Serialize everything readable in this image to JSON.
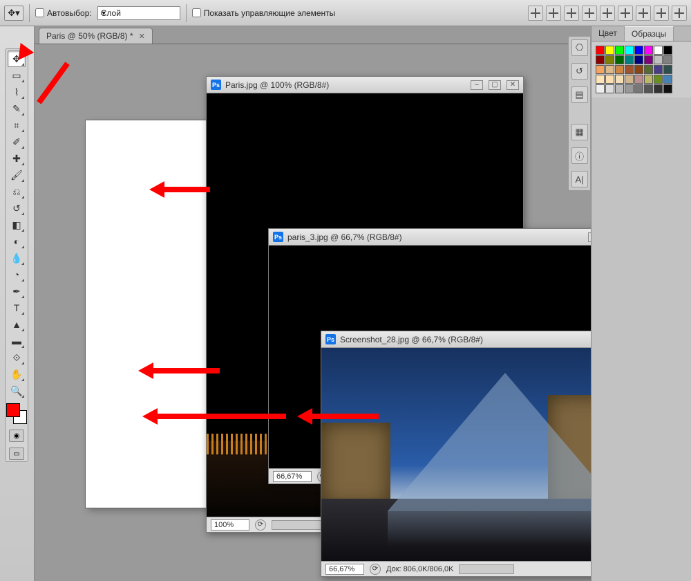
{
  "options": {
    "auto_select_label": "Автовыбор:",
    "auto_select_value": "Слой",
    "show_controls_label": "Показать управляющие элементы"
  },
  "main_tab": {
    "title": "Paris @ 50% (RGB/8) *"
  },
  "tools": [
    {
      "name": "move-tool",
      "glyph": "✥",
      "selected": true
    },
    {
      "name": "marquee-tool",
      "glyph": "▭"
    },
    {
      "name": "lasso-tool",
      "glyph": "⌇"
    },
    {
      "name": "quick-select-tool",
      "glyph": "✎"
    },
    {
      "name": "crop-tool",
      "glyph": "⌗"
    },
    {
      "name": "eyedropper-tool",
      "glyph": "✐"
    },
    {
      "name": "healing-tool",
      "glyph": "✚"
    },
    {
      "name": "brush-tool",
      "glyph": "🖌"
    },
    {
      "name": "stamp-tool",
      "glyph": "⎌"
    },
    {
      "name": "history-brush-tool",
      "glyph": "↺"
    },
    {
      "name": "eraser-tool",
      "glyph": "◧"
    },
    {
      "name": "gradient-tool",
      "glyph": "◐"
    },
    {
      "name": "blur-tool",
      "glyph": "💧"
    },
    {
      "name": "dodge-tool",
      "glyph": "◔"
    },
    {
      "name": "pen-tool",
      "glyph": "✒"
    },
    {
      "name": "type-tool",
      "glyph": "T"
    },
    {
      "name": "path-select-tool",
      "glyph": "▲"
    },
    {
      "name": "shape-tool",
      "glyph": "▬"
    },
    {
      "name": "3d-tool",
      "glyph": "⟐"
    },
    {
      "name": "hand-tool",
      "glyph": "✋"
    },
    {
      "name": "zoom-tool",
      "glyph": "🔍"
    }
  ],
  "fg_color": "#ff0000",
  "right_panel": {
    "tabs": [
      "Цвет",
      "Образцы"
    ],
    "active_tab_index": 1,
    "swatches": [
      "#ff0000",
      "#ffff00",
      "#00ff00",
      "#00ffff",
      "#0000ff",
      "#ff00ff",
      "#ffffff",
      "#000000",
      "#8b0000",
      "#808000",
      "#006400",
      "#008080",
      "#000080",
      "#800080",
      "#c0c0c0",
      "#808080",
      "#f4a460",
      "#deb887",
      "#cd853f",
      "#a0522d",
      "#8b4513",
      "#556b2f",
      "#483d8b",
      "#2f4f4f",
      "#ffe4b5",
      "#ffdead",
      "#f5deb3",
      "#d2b48c",
      "#bc8f8f",
      "#bdb76b",
      "#6b8e23",
      "#4682b4",
      "#eeeeee",
      "#dddddd",
      "#bbbbbb",
      "#999999",
      "#777777",
      "#555555",
      "#333333",
      "#111111"
    ],
    "dock_icons": [
      "navigator-icon",
      "history-icon",
      "layers-icon",
      "channels-icon",
      "info-icon",
      "character-icon"
    ]
  },
  "windows": [
    {
      "id": "w1",
      "title": "Paris.jpg @ 100% (RGB/8#)",
      "zoom": "100%",
      "doc_info": ""
    },
    {
      "id": "w2",
      "title": "paris_3.jpg @ 66,7% (RGB/8#)",
      "zoom": "66,67%",
      "doc_info": ""
    },
    {
      "id": "w3",
      "title": "Screenshot_28.jpg @ 66,7% (RGB/8#)",
      "zoom": "66,67%",
      "doc_info": "Док: 806,0K/806,0K"
    }
  ],
  "align_buttons": [
    "align-top",
    "align-vmid",
    "align-bottom",
    "align-left",
    "align-hmid",
    "align-right",
    "distribute-h",
    "distribute-v",
    "auto-align"
  ]
}
